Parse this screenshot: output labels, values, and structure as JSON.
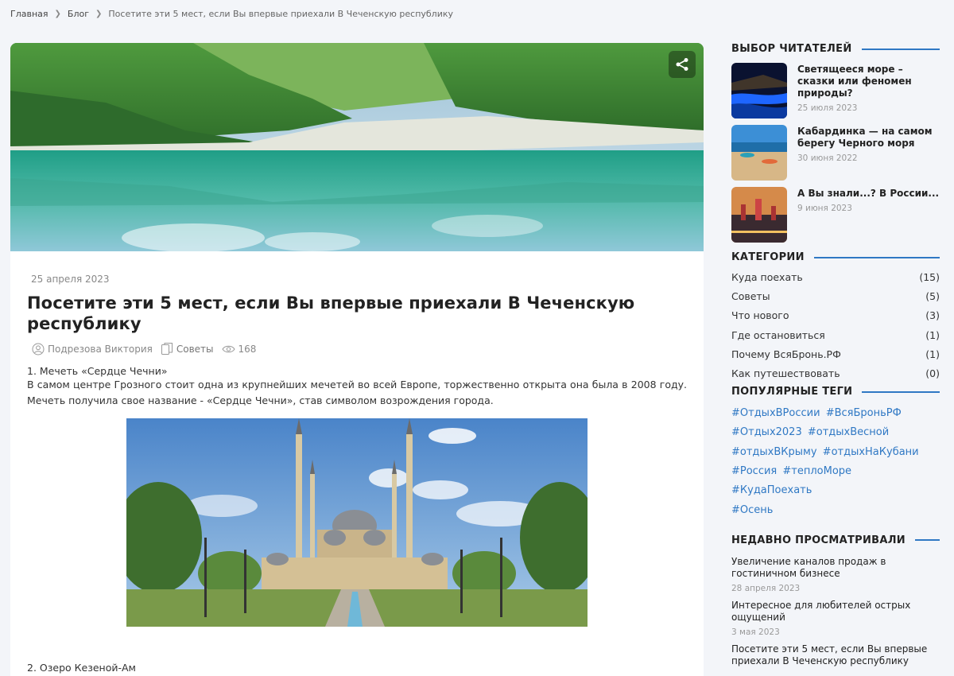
{
  "breadcrumb": {
    "home": "Главная",
    "blog": "Блог",
    "current": "Посетите эти 5 мест, если Вы впервые приехали В Чеченскую республику"
  },
  "article": {
    "date": "25 апреля 2023",
    "title": "Посетите эти 5 мест, если Вы впервые приехали В Чеченскую республику",
    "author": "Подрезова Виктория",
    "category": "Советы",
    "views": "168",
    "section1": "1. Мечеть «Сердце Чечни»",
    "paragraph1": "В самом центре Грозного стоит одна из крупнейших мечетей во всей Европе, торжественно открыта она была в 2008 году. Мечеть получила свое название - «Сердце Чечни», став символом возрождения города.",
    "section2": "2. Озеро Кезеной-Ам"
  },
  "sidebar": {
    "readers_choice": {
      "heading": "ВЫБОР ЧИТАТЕЛЕЙ",
      "items": [
        {
          "title": "Светящееся море – сказки или феномен природы?",
          "date": "25 июля 2023"
        },
        {
          "title": "Кабардинка — на самом берегу Черного моря",
          "date": "30 июня 2022"
        },
        {
          "title": "А Вы знали...? В России...",
          "date": "9 июня 2023"
        }
      ]
    },
    "categories": {
      "heading": "КАТЕГОРИИ",
      "items": [
        {
          "name": "Куда поехать",
          "count": "(15)"
        },
        {
          "name": "Советы",
          "count": "(5)"
        },
        {
          "name": "Что нового",
          "count": "(3)"
        },
        {
          "name": "Где остановиться",
          "count": "(1)"
        },
        {
          "name": "Почему ВсяБронь.РФ",
          "count": "(1)"
        },
        {
          "name": "Как путешествовать",
          "count": "(0)"
        }
      ]
    },
    "tags": {
      "heading": "ПОПУЛЯРНЫЕ ТЕГИ",
      "items": [
        "#ОтдыхВРоссии",
        "#ВсяБроньРФ",
        "#Отдых2023",
        "#отдыхВесной",
        "#отдыхВКрыму",
        "#отдыхНаКубани",
        "#Россия",
        "#теплоМоре",
        "#КудаПоехать",
        "#Осень"
      ]
    },
    "recent": {
      "heading": "НЕДАВНО ПРОСМАТРИВАЛИ",
      "items": [
        {
          "title": "Увеличение каналов продаж в гостиничном бизнесе",
          "date": "28 апреля 2023"
        },
        {
          "title": "Интересное для любителей острых ощущений",
          "date": "3 мая 2023"
        },
        {
          "title": "Посетите эти 5 мест, если Вы впервые приехали В Чеченскую республику",
          "date": ""
        }
      ]
    }
  },
  "colors": {
    "accent": "#2f78c4",
    "background": "#f3f5f9"
  },
  "icons": {
    "share": "share-icon",
    "author": "user-icon",
    "category": "copy-icon",
    "views": "eye-icon"
  }
}
